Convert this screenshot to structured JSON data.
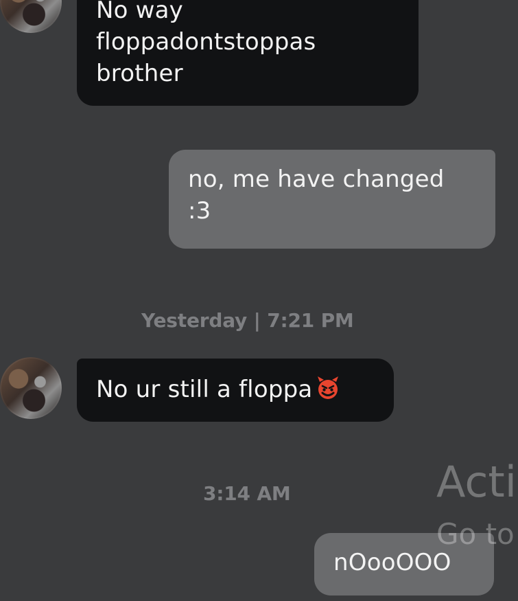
{
  "messages": [
    {
      "direction": "incoming",
      "text": "No way\nfloppadontstoppas\nbrother"
    },
    {
      "direction": "outgoing",
      "text": "no, me have changed\n:3"
    },
    {
      "direction": "incoming",
      "text": "No ur still a floppa",
      "emoji": "smiling-imp-emoji"
    },
    {
      "direction": "outgoing",
      "text": "nOooOOO"
    }
  ],
  "timestamps": [
    "Yesterday | 7:21 PM",
    "3:14 AM"
  ],
  "watermark": {
    "title": "Acti",
    "subtitle": "Go to"
  },
  "colors": {
    "background": "#3a3b3d",
    "incoming_bubble": "#111214",
    "outgoing_bubble": "#6a6b6d",
    "timestamp": "#7e7f82",
    "emoji": "#e8452f"
  }
}
